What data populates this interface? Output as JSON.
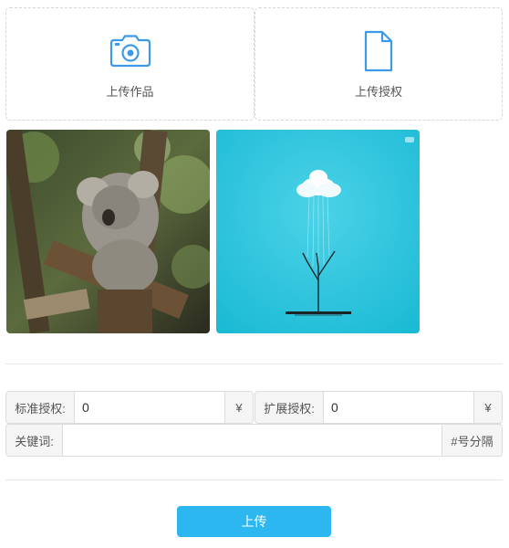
{
  "upload": {
    "work_label": "上传作品",
    "work_icon": "camera-icon",
    "license_label": "上传授权",
    "license_icon": "document-icon",
    "accent_color": "#3d9ae8"
  },
  "gallery": [
    {
      "subject": "koala-photo"
    },
    {
      "subject": "cloud-tree-photo"
    }
  ],
  "pricing": {
    "standard_label": "标准授权:",
    "standard_value": "0",
    "standard_currency": "¥",
    "extended_label": "扩展授权:",
    "extended_value": "0",
    "extended_currency": "¥"
  },
  "keywords": {
    "label": "关键词:",
    "value": "",
    "suffix": "#号分隔"
  },
  "submit": {
    "label": "上传",
    "color": "#2db7f0"
  }
}
